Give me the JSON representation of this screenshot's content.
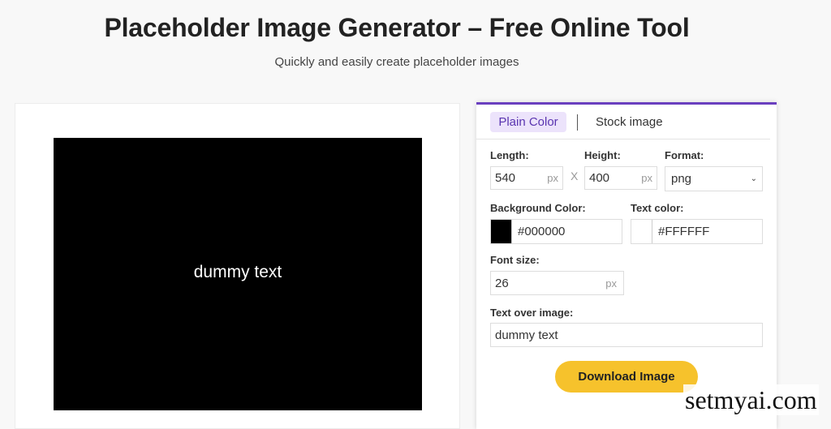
{
  "header": {
    "title": "Placeholder Image Generator – Free Online Tool",
    "subtitle": "Quickly and easily create placeholder images"
  },
  "preview": {
    "text": "dummy text",
    "background_color": "#000000",
    "text_color": "#FFFFFF"
  },
  "panel": {
    "accent_color": "#6a3fbf",
    "tabs": [
      {
        "label": "Plain Color",
        "active": true
      },
      {
        "label": "Stock image",
        "active": false
      }
    ],
    "length": {
      "label": "Length:",
      "value": "540",
      "unit": "px"
    },
    "separator": "X",
    "height": {
      "label": "Height:",
      "value": "400",
      "unit": "px"
    },
    "format": {
      "label": "Format:",
      "value": "png"
    },
    "background_color": {
      "label": "Background Color:",
      "value": "#000000"
    },
    "text_color": {
      "label": "Text color:",
      "value": "#FFFFFF"
    },
    "font_size": {
      "label": "Font size:",
      "value": "26",
      "unit": "px"
    },
    "text_over_image": {
      "label": "Text over image:",
      "value": "dummy text"
    },
    "download_label": "Download Image"
  },
  "watermark": "setmyai.com"
}
